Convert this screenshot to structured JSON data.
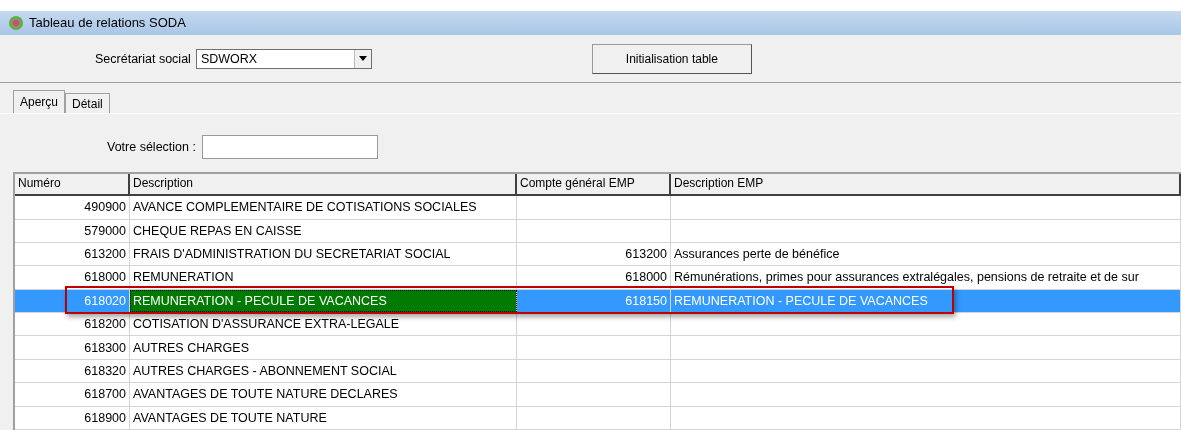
{
  "window": {
    "title": "Tableau de relations SODA"
  },
  "secretariat": {
    "label": "Secrétariat social",
    "value": "SDWORX"
  },
  "init_button": "Initialisation table",
  "tabs": [
    {
      "label": "Aperçu",
      "selected": true
    },
    {
      "label": "Détail",
      "selected": false
    }
  ],
  "selection": {
    "label": "Votre sélection :"
  },
  "table": {
    "columns": [
      "Numéro",
      "Description",
      "Compte général EMP",
      "Description EMP"
    ],
    "rows": [
      {
        "numero": "490900",
        "description": "AVANCE COMPLEMENTAIRE DE COTISATIONS SOCIALES",
        "selected": false
      },
      {
        "numero": "579000",
        "description": "CHEQUE REPAS EN CAISSE",
        "selected": false
      },
      {
        "numero": "613200",
        "description": "FRAIS D'ADMINISTRATION DU SECRETARIAT SOCIAL",
        "compte": "613200",
        "description_emp": "Assurances perte de bénéfice",
        "selected": false
      },
      {
        "numero": "618000",
        "description": "REMUNERATION",
        "compte": "618000",
        "description_emp": "Rémunérations, primes pour assurances extralégales, pensions de retraite et de sur",
        "selected": false
      },
      {
        "numero": "618020",
        "description": "REMUNERATION - PECULE DE VACANCES",
        "compte": "618150",
        "description_emp": "REMUNERATION - PECULE DE VACANCES",
        "selected": true
      },
      {
        "numero": "618200",
        "description": "COTISATION D'ASSURANCE EXTRA-LEGALE",
        "selected": false
      },
      {
        "numero": "618300",
        "description": "AUTRES CHARGES",
        "selected": false
      },
      {
        "numero": "618320",
        "description": "AUTRES CHARGES - ABONNEMENT SOCIAL",
        "selected": false
      },
      {
        "numero": "618700",
        "description": "AVANTAGES DE TOUTE NATURE DECLARES",
        "selected": false
      },
      {
        "numero": "618900",
        "description": "AVANTAGES DE TOUTE NATURE",
        "selected": false
      }
    ]
  }
}
